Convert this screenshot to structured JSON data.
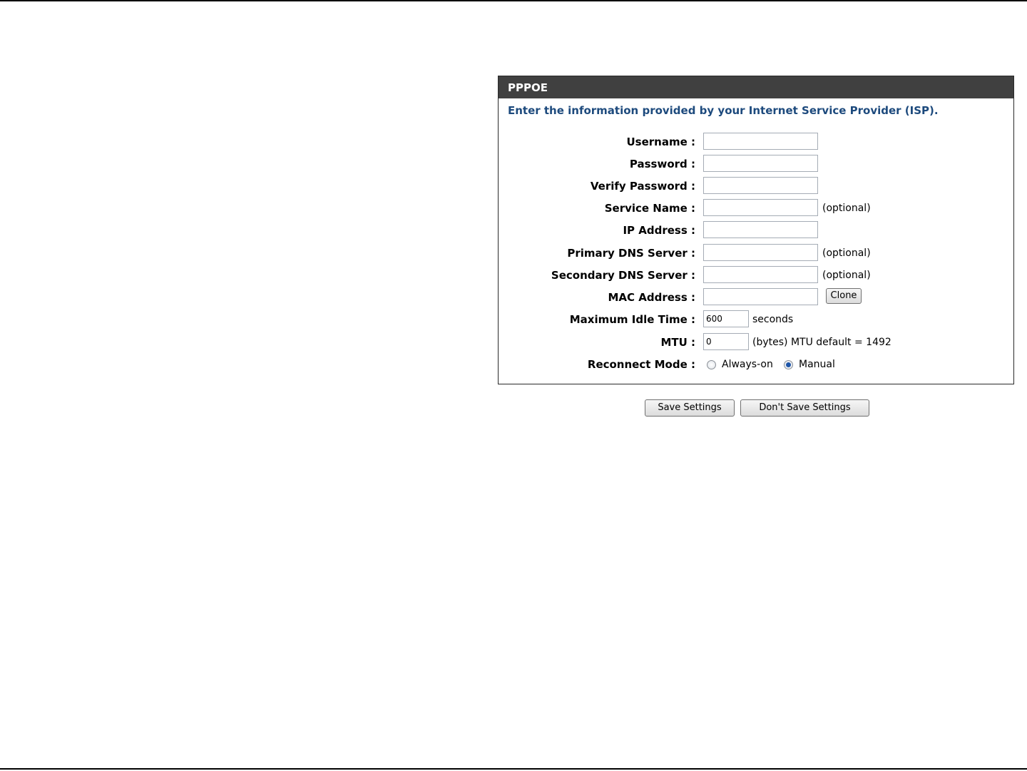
{
  "panel": {
    "title": "PPPOE",
    "intro": "Enter the information provided by your Internet Service Provider (ISP)."
  },
  "fields": {
    "username": {
      "label": "Username :",
      "value": ""
    },
    "password": {
      "label": "Password :",
      "value": ""
    },
    "verify_password": {
      "label": "Verify Password :",
      "value": ""
    },
    "service_name": {
      "label": "Service Name :",
      "value": "",
      "note": "(optional)"
    },
    "ip_address": {
      "label": "IP Address :",
      "value": ""
    },
    "primary_dns": {
      "label": "Primary DNS Server :",
      "value": "",
      "note": "(optional)"
    },
    "secondary_dns": {
      "label": "Secondary DNS Server :",
      "value": "",
      "note": "(optional)"
    },
    "mac_address": {
      "label": "MAC Address :",
      "value": "",
      "button": "Clone"
    },
    "max_idle_time": {
      "label": "Maximum Idle Time :",
      "value": "600",
      "note": "seconds"
    },
    "mtu": {
      "label": "MTU :",
      "value": "0",
      "note": "(bytes) MTU default = 1492"
    },
    "reconnect_mode": {
      "label": "Reconnect Mode :",
      "options": [
        "Always-on",
        "Manual"
      ],
      "selected": "Manual"
    }
  },
  "actions": {
    "save": "Save Settings",
    "dont_save": "Don't Save Settings"
  }
}
